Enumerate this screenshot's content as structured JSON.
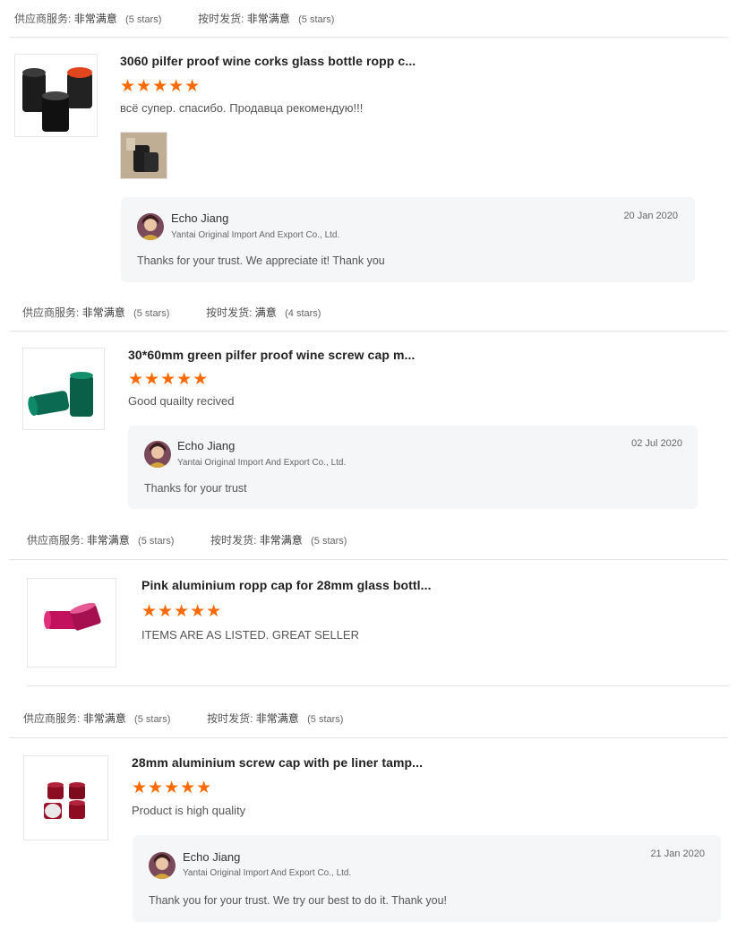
{
  "reviews": [
    {
      "ratings": {
        "supplier_label": "供应商服务:",
        "supplier_value": "非常满意",
        "supplier_count": "(5 stars)",
        "delivery_label": "按时发货:",
        "delivery_value": "非常满意",
        "delivery_count": "(5 stars)"
      },
      "product_title": "3060 pilfer proof wine corks glass bottle ropp c...",
      "stars": "★★★★★",
      "comment": "всё супер. спасибо. Продавца рекомендую!!!",
      "reply": {
        "name": "Echo Jiang",
        "company": "Yantai Original Import And Export Co., Ltd.",
        "date": "20 Jan 2020",
        "text": "Thanks for your trust. We appreciate it! Thank you"
      }
    },
    {
      "ratings": {
        "supplier_label": "供应商服务:",
        "supplier_value": "非常满意",
        "supplier_count": "(5 stars)",
        "delivery_label": "按时发货:",
        "delivery_value": "满意",
        "delivery_count": "(4 stars)"
      },
      "product_title": "30*60mm green pilfer proof wine screw cap m...",
      "stars": "★★★★★",
      "comment": "Good quailty recived",
      "reply": {
        "name": "Echo Jiang",
        "company": "Yantai Original Import And Export Co., Ltd.",
        "date": "02 Jul 2020",
        "text": "Thanks for your trust"
      }
    },
    {
      "ratings": {
        "supplier_label": "供应商服务:",
        "supplier_value": "非常满意",
        "supplier_count": "(5 stars)",
        "delivery_label": "按时发货:",
        "delivery_value": "非常满意",
        "delivery_count": "(5 stars)"
      },
      "product_title": "Pink aluminium ropp cap for 28mm glass bottl...",
      "stars": "★★★★★",
      "comment": "ITEMS ARE AS LISTED. GREAT SELLER"
    },
    {
      "ratings": {
        "supplier_label": "供应商服务:",
        "supplier_value": "非常满意",
        "supplier_count": "(5 stars)",
        "delivery_label": "按时发货:",
        "delivery_value": "非常满意",
        "delivery_count": "(5 stars)"
      },
      "product_title": "28mm aluminium screw cap with pe liner tamp...",
      "stars": "★★★★★",
      "comment": "Product is high quality",
      "reply": {
        "name": "Echo Jiang",
        "company": "Yantai Original Import And Export Co., Ltd.",
        "date": "21 Jan 2020",
        "text": "Thank you for your trust. We try our best to do it. Thank you!"
      }
    }
  ],
  "colors": {
    "star": "#ff6a00",
    "reply_bg": "#f5f6f8",
    "divider": "#e3e3e3"
  }
}
